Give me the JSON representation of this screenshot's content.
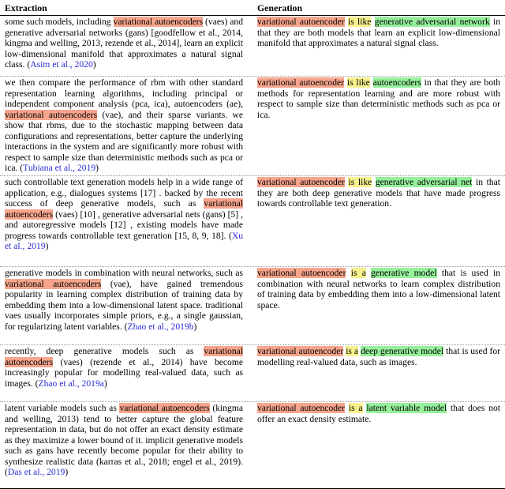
{
  "columns": {
    "extraction_header": "Extraction",
    "generation_header": "Generation"
  },
  "colors": {
    "entity_highlight": "#f7a58d",
    "relation_highlight": "#f7f18d",
    "tail_highlight": "#96f09b",
    "citation_link": "#2a2ad6"
  },
  "rows": [
    {
      "extraction": {
        "pre": "some such models, including ",
        "entity": "variational autoencoders",
        "post": " (vaes) and generative adversarial networks (gans) [goodfellow et al., 2014, kingma and welling, 2013, rezende et al., 2014], learn an explicit low-dimensional manifold that approximates a natural signal class. (",
        "citation": "Asim et al., 2020",
        "tail": ")"
      },
      "generation": {
        "head": "variational autoencoder",
        "relation": "is like",
        "tail_entity": "generative adversarial network",
        "rest": " in that they are both models that learn an explicit low-dimensional manifold that approximates a natural signal class."
      }
    },
    {
      "extraction": {
        "pre": "we then compare the performance of rbm with other standard representation learning algorithms, including principal or independent component analysis (pca, ica), autoencoders (ae), ",
        "entity": "variational autoencoders",
        "post": " (vae), and their sparse variants. we show that rbms, due to the stochastic mapping between data configurations and representations, better capture the underlying interactions in the system and are significantly more robust with respect to sample size than deterministic methods such as pca or ica. (",
        "citation": "Tubiana et al., 2019",
        "tail": ")"
      },
      "generation": {
        "head": "variational autoencoder",
        "relation": "is like",
        "tail_entity": "autoencoders",
        "rest": " in that they are both methods for representation learning and are more robust with respect to sample size than deterministic methods such as pca or ica."
      }
    },
    {
      "extraction": {
        "pre": "such controllable text generation models help in a wide range of application, e.g., dialogues systems [17] . backed by the recent success of deep generative models, such as ",
        "entity": "variational autoencoders",
        "post": " (vaes) [10] , generative adversarial nets (gans) [5] , and autoregressive models [12] , existing models have made progress towards controllable text generation [15, 8, 9, 18]. (",
        "citation": "Xu et al., 2019",
        "tail": ")"
      },
      "generation": {
        "head": "variational autoencoder",
        "relation": "is like",
        "tail_entity": "generative adversarial net",
        "rest": " in that they are both deep generative models that have made progress towards controllable text generation."
      }
    },
    {
      "extraction": {
        "pre": "generative models in combination with neural networks, such as ",
        "entity": "variational autoencoders",
        "post": " (vae), have gained tremendous popularity in learning complex distribution of training data by embedding them into a low-dimensional latent space. traditional vaes usually incorporates simple priors, e.g., a single gaussian, for regularizing latent variables. (",
        "citation": "Zhao et al., 2019b",
        "tail": ")"
      },
      "generation": {
        "head": "variational autoencoder",
        "relation": "is a",
        "tail_entity": "generative model",
        "rest": " that is used in combination with neural networks to learn complex distribution of training data by embedding them into a low-dimensional latent space."
      }
    },
    {
      "extraction": {
        "pre": "recently, deep generative models such as ",
        "entity": "variational autoencoders",
        "post": " (vaes) (rezende et al., 2014) have become increasingly popular for modelling real-valued data, such as images. (",
        "citation": "Zhao et al., 2019a",
        "tail": ")"
      },
      "generation": {
        "head": "variational autoencoder",
        "relation": "is a",
        "tail_entity": "deep generative model",
        "rest": " that is used for modelling real-valued data, such as images."
      }
    },
    {
      "extraction": {
        "pre": "latent variable models such as ",
        "entity": "variational autoencoders",
        "post": " (kingma and welling, 2013) tend to better capture the global feature representation in data, but do not offer an exact density estimate as they maximize a lower bound of it. implicit generative models such as gans have recently become popular for their ability to synthesize realistic data (karras et al., 2018; engel et al., 2019). (",
        "citation": "Das et al., 2019",
        "tail": ")"
      },
      "generation": {
        "head": "variational autoencoder",
        "relation": "is a",
        "tail_entity": "latent variable model",
        "rest": " that does not offer an exact density estimate."
      }
    }
  ]
}
